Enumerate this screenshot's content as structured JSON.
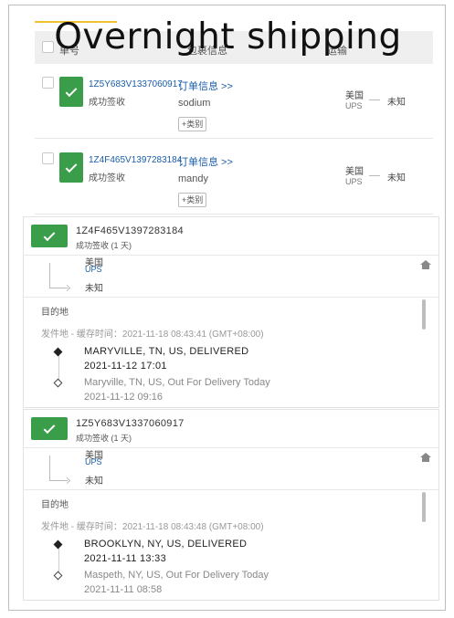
{
  "title_overlay": "Overnight shipping",
  "table": {
    "columns": {
      "tracking_no": "单号",
      "package_info": "包裹信息",
      "shipping_route": "运输"
    },
    "rows": [
      {
        "tracking_no": "1Z5Y683V1337060917",
        "status": "成功签收",
        "order_info": "订单信息 >>",
        "name": "sodium",
        "tag_button": "+类别",
        "origin_country": "美国",
        "carrier": "UPS",
        "destination": "未知"
      },
      {
        "tracking_no": "1Z4F465V1397283184",
        "status": "成功签收",
        "order_info": "订单信息 >>",
        "name": "mandy",
        "tag_button": "+类别",
        "origin_country": "美国",
        "carrier": "UPS",
        "destination": "未知"
      }
    ]
  },
  "panels": [
    {
      "tracking_no": "1Z4F465V1397283184",
      "status": "成功签收 (1 天)",
      "origin_country": "美国",
      "carrier": "UPS",
      "destination": "未知",
      "destination_label": "目的地",
      "origin_label": "发件地 - 缓存时间：2021-11-18 08:43:41 (GMT+08:00)",
      "events": [
        {
          "desc": "MARYVILLE, TN, US, DELIVERED",
          "time": "2021-11-12 17:01",
          "latest": true
        },
        {
          "desc": "Maryville, TN, US, Out For Delivery Today",
          "time": "2021-11-12 09:16",
          "latest": false
        }
      ]
    },
    {
      "tracking_no": "1Z5Y683V1337060917",
      "status": "成功签收 (1 天)",
      "origin_country": "美国",
      "carrier": "UPS",
      "destination": "未知",
      "destination_label": "目的地",
      "origin_label": "发件地 - 缓存时间：2021-11-18 08:43:48 (GMT+08:00)",
      "events": [
        {
          "desc": "BROOKLYN, NY, US, DELIVERED",
          "time": "2021-11-11 13:33",
          "latest": true
        },
        {
          "desc": "Maspeth, NY, US, Out For Delivery Today",
          "time": "2021-11-11 08:58",
          "latest": false
        }
      ]
    }
  ],
  "colors": {
    "success_green": "#3a9d4a",
    "link_blue": "#1a5ea8",
    "accent_gold": "#f1c232"
  },
  "icons": [
    "checkmark-icon",
    "home-icon",
    "route-arrow-icon",
    "timeline-diamond-icon"
  ]
}
